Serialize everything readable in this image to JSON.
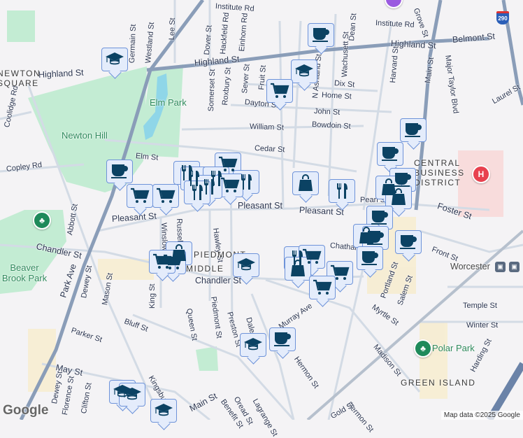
{
  "streets": [
    "Institute Rd",
    "Institute Rd",
    "Highland St",
    "Highland St",
    "Highland St",
    "Belmont St",
    "Elm St",
    "Copley Rd",
    "Coolidge Rd",
    "Pleasant St",
    "Pleasant St",
    "Pleasant St",
    "Chandler St",
    "Chandler St",
    "Park Ave",
    "Abbott St",
    "Dewey St",
    "Mason St",
    "King St",
    "Queen St",
    "Piedmont St",
    "Hawley St",
    "Preston St",
    "Dale St",
    "Bluff St",
    "Parker St",
    "May St",
    "Kingsbury St",
    "Main St",
    "Main St",
    "Oread St",
    "Lagrange St",
    "Hermon St",
    "Hermon St",
    "Murray Ave",
    "Madison St",
    "Myrtle St",
    "Portland St",
    "Salem St",
    "Temple St",
    "Winter St",
    "Harding St",
    "Front St",
    "Foster St",
    "Chatham St",
    "Pearl St",
    "William St",
    "Bowdoin St",
    "Cedar St",
    "John St",
    "Home St",
    "Dix St",
    "Dayton St",
    "Wachusett St",
    "Harvard St",
    "Dean St",
    "Grove St",
    "Main St",
    "Major Taylor Blvd",
    "Laurel St",
    "Somerset St",
    "Roxbury St",
    "Sever St",
    "Dover St",
    "Hackfeld Rd",
    "Einhorn Rd",
    "Westland St",
    "Lee St",
    "Germain St",
    "Fruit St",
    "Dewey St",
    "Florence St",
    "Clifton St",
    "Gold St",
    "Benefit St",
    "N Ashland St",
    "Russell St",
    "Winslow St"
  ],
  "areas": {
    "newton_square": "NEWTON SQUARE",
    "piedmont": "PIEDMONT",
    "middle": "MIDDLE",
    "central_business_district": "CENTRAL BUSINESS DISTRICT",
    "green_island": "GREEN ISLAND"
  },
  "parks": {
    "elm_park": "Elm Park",
    "newton_hill": "Newton Hill",
    "beaver_brook": "Beaver Brook Park",
    "polar_park": "Polar Park"
  },
  "places": {
    "worcester": "Worcester",
    "hospital": "H",
    "interstate": "290"
  },
  "footer": {
    "logo": "Google",
    "attribution": "Map data ©2025 Google"
  },
  "colors": {
    "marker_bg": "#e4ecfb",
    "marker_border": "#6e93d9",
    "icon": "#0b4263",
    "park": "#c3ecd3",
    "arterial": "#8a9db8",
    "hospital": "#e8414f"
  }
}
